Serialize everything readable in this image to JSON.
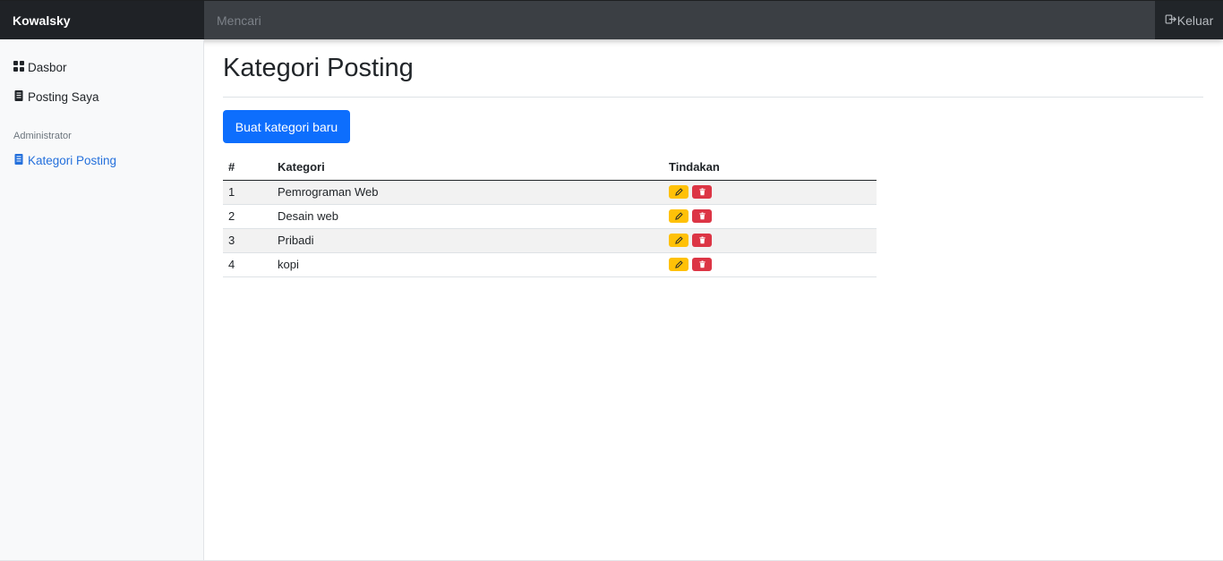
{
  "navbar": {
    "brand": "Kowalsky",
    "search_placeholder": "Mencari",
    "logout_label": "Keluar"
  },
  "sidebar": {
    "items": [
      {
        "label": "Dasbor",
        "icon": "dashboard-grid-icon"
      },
      {
        "label": "Posting Saya",
        "icon": "document-icon"
      }
    ],
    "admin_heading": "Administrator",
    "admin_items": [
      {
        "label": "Kategori Posting",
        "icon": "document-icon",
        "active": true
      }
    ]
  },
  "main": {
    "title": "Kategori Posting",
    "create_button": "Buat kategori baru",
    "table": {
      "headers": [
        "#",
        "Kategori",
        "Tindakan"
      ],
      "rows": [
        {
          "num": "1",
          "category": "Pemrograman Web"
        },
        {
          "num": "2",
          "category": "Desain web"
        },
        {
          "num": "3",
          "category": "Pribadi"
        },
        {
          "num": "4",
          "category": "kopi"
        }
      ]
    }
  },
  "colors": {
    "primary": "#0d6efd",
    "edit": "#ffc107",
    "delete": "#dc3545",
    "active_link": "#2470dc",
    "navbar": "#343a40"
  }
}
